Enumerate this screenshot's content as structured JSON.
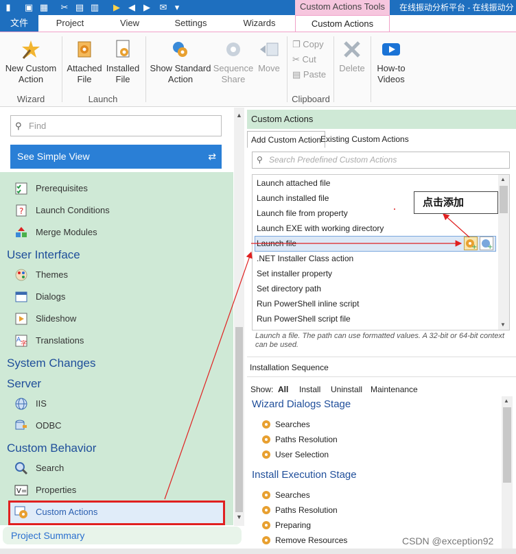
{
  "titlebar": {
    "context_tools": "Custom Actions Tools",
    "app_title": "在线振动分析平台 - 在线振动分"
  },
  "tabs": {
    "file": "文件",
    "items": [
      "Project",
      "View",
      "Settings",
      "Wizards",
      "Custom Actions"
    ]
  },
  "ribbon": {
    "new_custom_action": "New Custom Action",
    "attached_file": "Attached File",
    "installed_file": "Installed File",
    "show_standard_action": "Show Standard Action",
    "sequence_share": "Sequence Share",
    "move": "Move",
    "copy": "Copy",
    "cut": "Cut",
    "paste": "Paste",
    "delete": "Delete",
    "how_to_videos": "How-to Videos",
    "groups": {
      "wizard": "Wizard",
      "launch": "Launch",
      "clipboard": "Clipboard"
    }
  },
  "left": {
    "find_placeholder": "Find",
    "simple_view": "See Simple View",
    "items": {
      "prerequisites": "Prerequisites",
      "launch_conditions": "Launch Conditions",
      "merge_modules": "Merge Modules",
      "user_interface": "User Interface",
      "themes": "Themes",
      "dialogs": "Dialogs",
      "slideshow": "Slideshow",
      "translations": "Translations",
      "system_changes": "System Changes",
      "server": "Server",
      "iis": "IIS",
      "odbc": "ODBC",
      "custom_behavior": "Custom Behavior",
      "search": "Search",
      "properties": "Properties",
      "custom_actions": "Custom Actions"
    },
    "project_summary": "Project Summary"
  },
  "right": {
    "header": "Custom Actions",
    "tab_add": "Add Custom Action",
    "tab_existing": "Existing Custom Actions",
    "search_placeholder": "Search Predefined Custom Actions",
    "list": [
      "Launch attached file",
      "Launch installed file",
      "Launch file from property",
      "Launch EXE with working directory",
      "Launch file",
      ".NET Installer Class action",
      "Set installer property",
      "Set directory path",
      "Run PowerShell inline script",
      "Run PowerShell script file"
    ],
    "description": "Launch a file. The path can use formatted values. A 32-bit or 64-bit context can be used.",
    "install_sequence": "Installation Sequence",
    "show_label": "Show:",
    "show_options": [
      "All",
      "Install",
      "Uninstall",
      "Maintenance"
    ],
    "wizard_stage": "Wizard Dialogs Stage",
    "wizard_items": [
      "Searches",
      "Paths Resolution",
      "User Selection"
    ],
    "exec_stage": "Install Execution Stage",
    "exec_items": [
      "Searches",
      "Paths Resolution",
      "Preparing",
      "Remove Resources"
    ]
  },
  "annotation": {
    "callout": "点击添加",
    "watermark": "CSDN @exception92"
  }
}
